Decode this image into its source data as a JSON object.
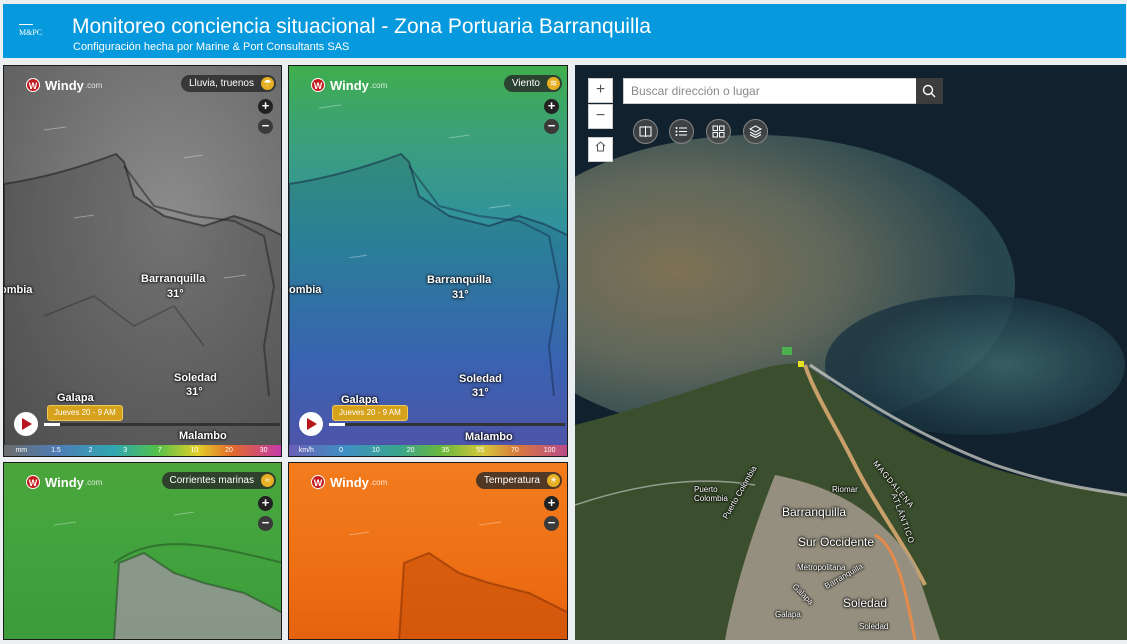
{
  "header": {
    "logo_text": "M&PC",
    "title": "Monitoreo conciencia situacional - Zona Portuaria Barranquilla",
    "subtitle": "Configuración hecha por Marine & Port Consultants SAS"
  },
  "windy_brand": "Windy",
  "windy_brand_suffix": ".com",
  "panels": {
    "rain": {
      "layer": "Lluvia, truenos",
      "cities": {
        "barranquilla": "Barranquilla",
        "barranquilla_temp": "31°",
        "soledad": "Soledad",
        "soledad_temp": "31°",
        "galapa": "Galapa",
        "malambo": "Malambo",
        "colombia": "ombia"
      },
      "time": "Jueves 20 - 9 AM",
      "scale_unit": "mm",
      "scale": [
        "1.5",
        "2",
        "3",
        "7",
        "10",
        "20",
        "30"
      ]
    },
    "wind": {
      "layer": "Viento",
      "cities": {
        "barranquilla": "Barranquilla",
        "barranquilla_temp": "31°",
        "soledad": "Soledad",
        "soledad_temp": "31°",
        "galapa": "Galapa",
        "malambo": "Malambo",
        "colombia": "ombia"
      },
      "time": "Jueves 20 - 9 AM",
      "scale_unit": "km/h",
      "scale": [
        "0",
        "10",
        "20",
        "35",
        "55",
        "70",
        "100"
      ]
    },
    "currents": {
      "layer": "Corrientes marinas"
    },
    "temperature": {
      "layer": "Temperatura"
    }
  },
  "zoom": {
    "in": "+",
    "out": "−"
  },
  "map": {
    "search_placeholder": "Buscar dirección o lugar",
    "labels": {
      "puerto_colombia": "Puerto\nColombia",
      "puerto_colombia_road": "Puerto Colombia",
      "riomar": "Riomar",
      "magdalena": "MAGDALENA",
      "atlantico": "ATLÁNTICO",
      "barranquilla": "Barranquilla",
      "barranquilla_road": "Barranquilla",
      "sur_occidente": "Sur Occidente",
      "metropolitana": "Metropolitana",
      "soledad": "Soledad",
      "galapa_road": "Galapa",
      "galapa": "Galapa",
      "soledad_road": "Soledad"
    }
  }
}
